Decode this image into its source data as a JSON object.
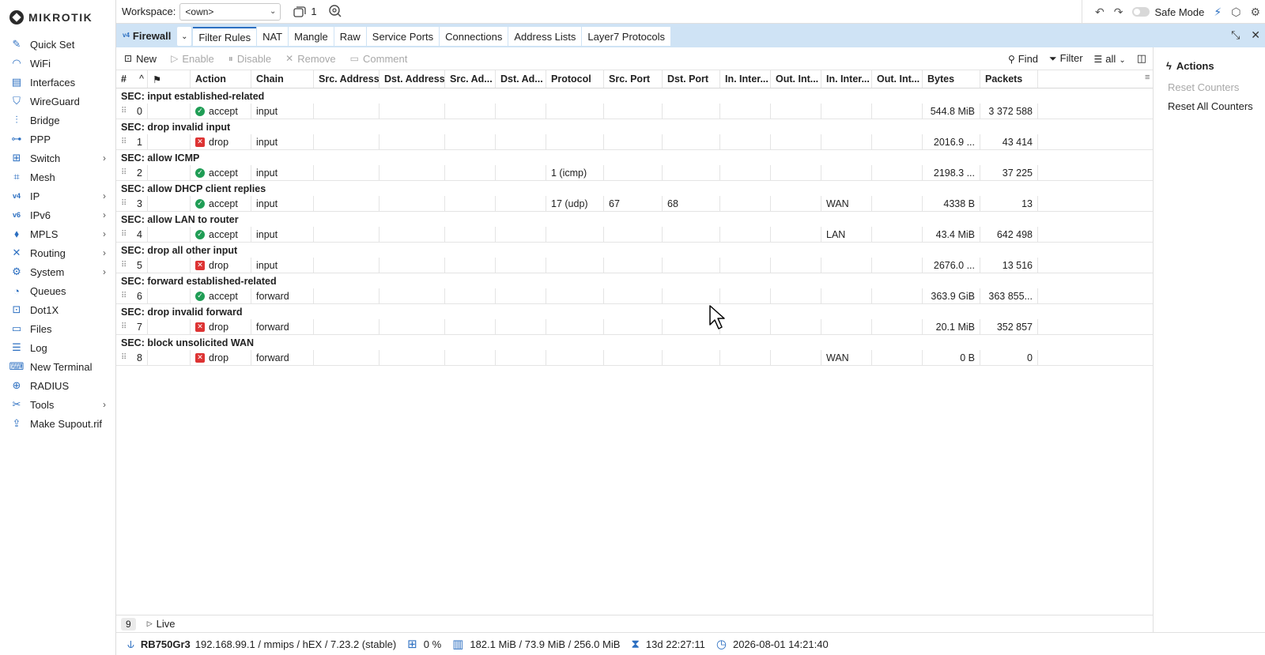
{
  "app": {
    "brand": "MIKROTIK"
  },
  "sidebar": {
    "items": [
      {
        "label": "Quick Set",
        "icon": "wand-icon",
        "glyph": "✎",
        "chevron": false
      },
      {
        "label": "WiFi",
        "icon": "wifi-icon",
        "glyph": "◠",
        "chevron": false
      },
      {
        "label": "Interfaces",
        "icon": "interfaces-icon",
        "glyph": "▤",
        "chevron": false
      },
      {
        "label": "WireGuard",
        "icon": "wireguard-shield-icon",
        "glyph": "⛉",
        "chevron": false
      },
      {
        "label": "Bridge",
        "icon": "bridge-icon",
        "glyph": "⫶",
        "chevron": false
      },
      {
        "label": "PPP",
        "icon": "ppp-icon",
        "glyph": "⊶",
        "chevron": false
      },
      {
        "label": "Switch",
        "icon": "switch-icon",
        "glyph": "⊞",
        "chevron": true
      },
      {
        "label": "Mesh",
        "icon": "mesh-icon",
        "glyph": "⌗",
        "chevron": false
      },
      {
        "label": "IP",
        "icon": "ip-icon",
        "glyph": "v4",
        "chevron": true
      },
      {
        "label": "IPv6",
        "icon": "ipv6-icon",
        "glyph": "v6",
        "chevron": true
      },
      {
        "label": "MPLS",
        "icon": "mpls-tag-icon",
        "glyph": "⬧",
        "chevron": true
      },
      {
        "label": "Routing",
        "icon": "routing-icon",
        "glyph": "✕",
        "chevron": true
      },
      {
        "label": "System",
        "icon": "system-gear-icon",
        "glyph": "⚙",
        "chevron": true
      },
      {
        "label": "Queues",
        "icon": "queues-icon",
        "glyph": "◔",
        "chevron": false
      },
      {
        "label": "Dot1X",
        "icon": "dot1x-icon",
        "glyph": "⊡",
        "chevron": false
      },
      {
        "label": "Files",
        "icon": "folder-icon",
        "glyph": "▭",
        "chevron": false
      },
      {
        "label": "Log",
        "icon": "log-icon",
        "glyph": "☰",
        "chevron": false
      },
      {
        "label": "New Terminal",
        "icon": "terminal-icon",
        "glyph": "⌨",
        "chevron": false
      },
      {
        "label": "RADIUS",
        "icon": "radius-icon",
        "glyph": "⊕",
        "chevron": false
      },
      {
        "label": "Tools",
        "icon": "tools-icon",
        "glyph": "✂",
        "chevron": true
      },
      {
        "label": "Make Supout.rif",
        "icon": "supout-icon",
        "glyph": "⇪",
        "chevron": false
      }
    ]
  },
  "topbar": {
    "workspace_label": "Workspace:",
    "workspace_value": "<own>",
    "window_count": "1",
    "safe_mode_label": "Safe Mode"
  },
  "tabsbar": {
    "window_title": "Firewall",
    "window_badge": "v4",
    "tabs": [
      "Filter Rules",
      "NAT",
      "Mangle",
      "Raw",
      "Service Ports",
      "Connections",
      "Address Lists",
      "Layer7 Protocols"
    ]
  },
  "toolbar": {
    "new": "New",
    "enable": "Enable",
    "disable": "Disable",
    "remove": "Remove",
    "comment": "Comment",
    "find": "Find",
    "filter": "Filter",
    "all": "all"
  },
  "table": {
    "headers": [
      "#",
      "",
      "Action",
      "Chain",
      "Src. Address",
      "Dst. Address",
      "Src. Ad...",
      "Dst. Ad...",
      "Protocol",
      "Src. Port",
      "Dst. Port",
      "In. Inter...",
      "Out. Int...",
      "In. Inter...",
      "Out. Int...",
      "Bytes",
      "Packets"
    ],
    "rows": [
      {
        "comment": "SEC: input established-related",
        "num": "0",
        "action": "accept",
        "chain": "input",
        "protocol": "",
        "src_port": "",
        "dst_port": "",
        "in_iface_list": "",
        "bytes": "544.8 MiB",
        "packets": "3 372 588"
      },
      {
        "comment": "SEC: drop invalid input",
        "num": "1",
        "action": "drop",
        "chain": "input",
        "protocol": "",
        "src_port": "",
        "dst_port": "",
        "in_iface_list": "",
        "bytes": "2016.9 ...",
        "packets": "43 414"
      },
      {
        "comment": "SEC: allow ICMP",
        "num": "2",
        "action": "accept",
        "chain": "input",
        "protocol": "1 (icmp)",
        "src_port": "",
        "dst_port": "",
        "in_iface_list": "",
        "bytes": "2198.3 ...",
        "packets": "37 225"
      },
      {
        "comment": "SEC: allow DHCP client replies",
        "num": "3",
        "action": "accept",
        "chain": "input",
        "protocol": "17 (udp)",
        "src_port": "67",
        "dst_port": "68",
        "in_iface_list": "WAN",
        "bytes": "4338 B",
        "packets": "13"
      },
      {
        "comment": "SEC: allow LAN to router",
        "num": "4",
        "action": "accept",
        "chain": "input",
        "protocol": "",
        "src_port": "",
        "dst_port": "",
        "in_iface_list": "LAN",
        "bytes": "43.4 MiB",
        "packets": "642 498"
      },
      {
        "comment": "SEC: drop all other input",
        "num": "5",
        "action": "drop",
        "chain": "input",
        "protocol": "",
        "src_port": "",
        "dst_port": "",
        "in_iface_list": "",
        "bytes": "2676.0 ...",
        "packets": "13 516"
      },
      {
        "comment": "SEC: forward established-related",
        "num": "6",
        "action": "accept",
        "chain": "forward",
        "protocol": "",
        "src_port": "",
        "dst_port": "",
        "in_iface_list": "",
        "bytes": "363.9 GiB",
        "packets": "363 855..."
      },
      {
        "comment": "SEC: drop invalid forward",
        "num": "7",
        "action": "drop",
        "chain": "forward",
        "protocol": "",
        "src_port": "",
        "dst_port": "",
        "in_iface_list": "",
        "bytes": "20.1 MiB",
        "packets": "352 857"
      },
      {
        "comment": "SEC: block unsolicited WAN",
        "num": "8",
        "action": "drop",
        "chain": "forward",
        "protocol": "",
        "src_port": "",
        "dst_port": "",
        "in_iface_list": "WAN",
        "bytes": "0 B",
        "packets": "0"
      }
    ]
  },
  "actions_panel": {
    "title": "Actions",
    "reset_counters": "Reset Counters",
    "reset_all_counters": "Reset All Counters"
  },
  "footer": {
    "row_count": "9",
    "live": "Live"
  },
  "statusbar": {
    "board": "RB750Gr3",
    "info": "192.168.99.1 / mmips / hEX / 7.23.2 (stable)",
    "cpu": "0 %",
    "memory": "182.1 MiB / 73.9 MiB / 256.0 MiB",
    "uptime": "13d 22:27:11",
    "datetime": "2026-08-01 14:21:40"
  },
  "colors": {
    "accent": "#2c6fc1",
    "tabs_bg": "#cfe3f5",
    "accept": "#1f9d55",
    "drop": "#dd3333"
  }
}
